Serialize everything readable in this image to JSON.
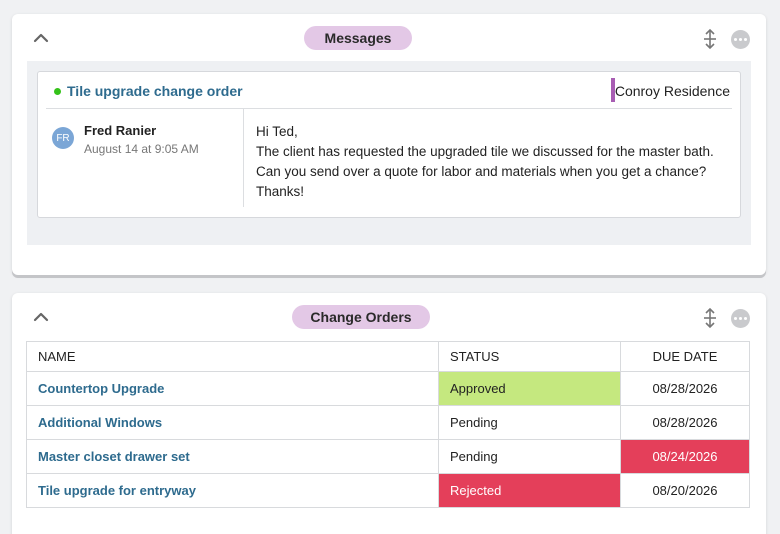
{
  "colors": {
    "accent_link": "#2e6b8e",
    "pill_bg": "#e3c8e6",
    "status_dot": "#35c21a",
    "project_bar": "#a85db3",
    "approved": "#c5e87f",
    "rejected": "#e43f5a",
    "overdue": "#e43f5a"
  },
  "messages": {
    "title": "Messages",
    "icons": [
      "chevron-up-icon",
      "move-icon",
      "more-icon"
    ],
    "thread": {
      "subject": "Tile upgrade change order",
      "project": "Conroy Residence",
      "sender": {
        "initials": "FR",
        "name": "Fred Ranier",
        "time": "August 14 at 9:05 AM"
      },
      "body_lines": [
        "Hi Ted,",
        "The client has requested the upgraded tile we discussed for the master bath.",
        "Can you send over a quote for labor and materials when you get a chance?",
        "Thanks!"
      ]
    }
  },
  "change_orders": {
    "title": "Change Orders",
    "columns": [
      "NAME",
      "STATUS",
      "DUE DATE"
    ],
    "rows": [
      {
        "name": "Countertop Upgrade",
        "status": "Approved",
        "due": "08/28/2026"
      },
      {
        "name": "Additional Windows",
        "status": "Pending",
        "due": "08/28/2026"
      },
      {
        "name": "Master closet drawer set",
        "status": "Pending",
        "due": "08/24/2026"
      },
      {
        "name": "Tile upgrade for entryway",
        "status": "Rejected",
        "due": "08/20/2026"
      }
    ]
  }
}
